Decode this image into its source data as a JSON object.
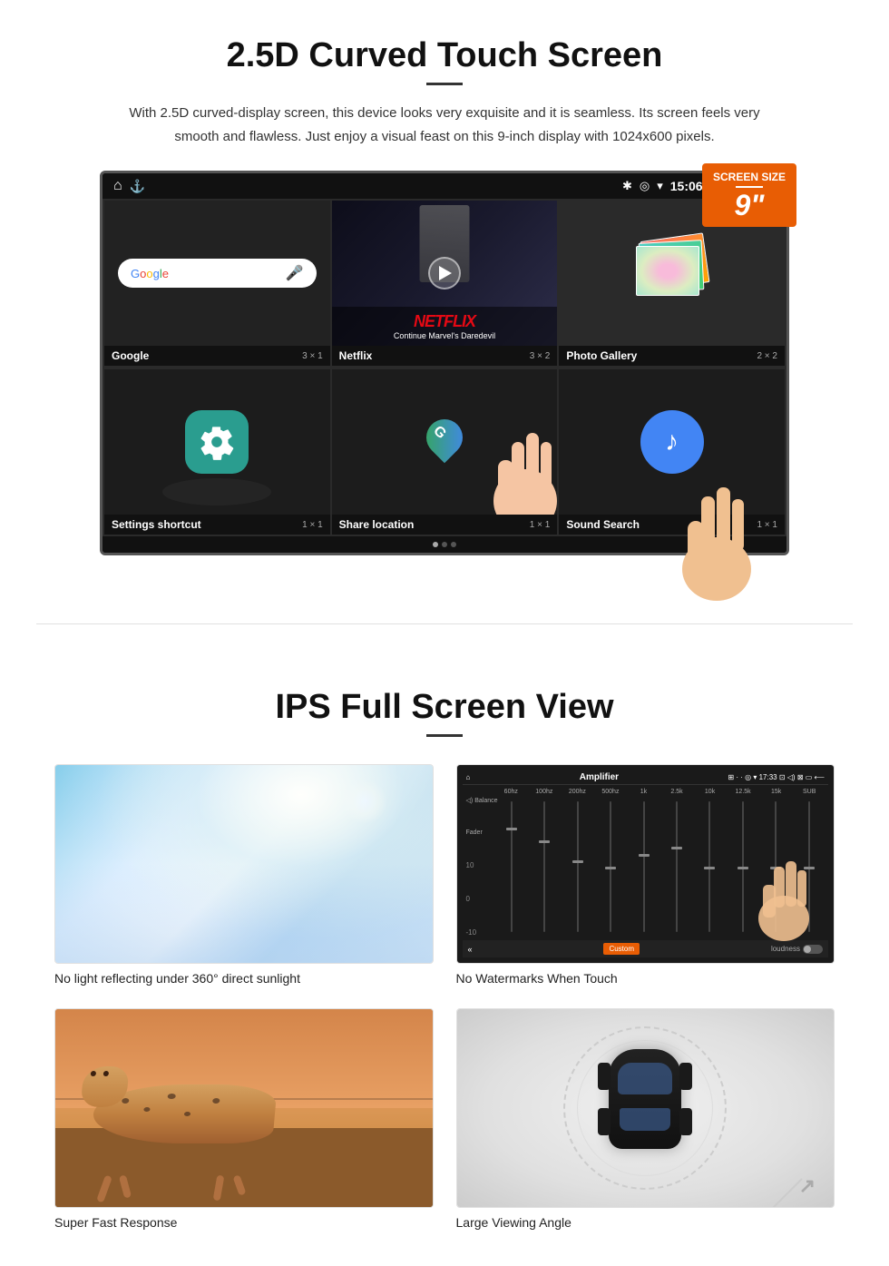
{
  "section1": {
    "title": "2.5D Curved Touch Screen",
    "description": "With 2.5D curved-display screen, this device looks very exquisite and it is seamless. Its screen feels very smooth and flawless. Just enjoy a visual feast on this 9-inch display with 1024x600 pixels.",
    "badge": {
      "label": "Screen Size",
      "size": "9\""
    },
    "statusBar": {
      "time": "15:06"
    },
    "apps": [
      {
        "name": "Google",
        "size": "3 × 1"
      },
      {
        "name": "Netflix",
        "size": "3 × 2"
      },
      {
        "name": "Photo Gallery",
        "size": "2 × 2"
      },
      {
        "name": "Settings shortcut",
        "size": "1 × 1"
      },
      {
        "name": "Share location",
        "size": "1 × 1"
      },
      {
        "name": "Sound Search",
        "size": "1 × 1"
      }
    ],
    "netflix": {
      "logo": "NETFLIX",
      "subtitle": "Continue Marvel's Daredevil"
    }
  },
  "section2": {
    "title": "IPS Full Screen View",
    "features": [
      {
        "id": "sunlight",
        "caption": "No light reflecting under 360° direct sunlight"
      },
      {
        "id": "watermark",
        "caption": "No Watermarks When Touch"
      },
      {
        "id": "cheetah",
        "caption": "Super Fast Response"
      },
      {
        "id": "car",
        "caption": "Large Viewing Angle"
      }
    ],
    "amplifier": {
      "title": "Amplifier",
      "customLabel": "Custom",
      "loudnessLabel": "loudness",
      "labels": [
        "60hz",
        "100hz",
        "200hz",
        "500hz",
        "1k",
        "2.5k",
        "10k",
        "12.5k",
        "15k",
        "SUB"
      ],
      "sideLabels": [
        "Balance",
        "Fader"
      ],
      "values": [
        "10",
        "0",
        "-10"
      ]
    }
  }
}
